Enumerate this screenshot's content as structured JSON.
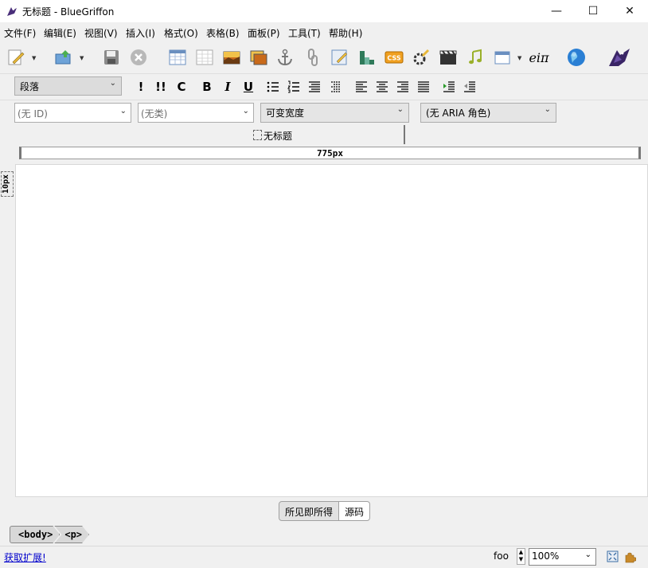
{
  "window": {
    "title": "无标题 - BlueGriffon",
    "minimize_glyph": "—",
    "maximize_glyph": "☐",
    "close_glyph": "✕"
  },
  "menu": [
    {
      "label": "文件(F)"
    },
    {
      "label": "编辑(E)"
    },
    {
      "label": "视图(V)"
    },
    {
      "label": "插入(I)"
    },
    {
      "label": "格式(O)"
    },
    {
      "label": "表格(B)"
    },
    {
      "label": "面板(P)"
    },
    {
      "label": "工具(T)"
    },
    {
      "label": "帮助(H)"
    }
  ],
  "toolbar": {
    "icons": [
      "new-document-icon",
      "publish-icon",
      "save-icon",
      "stop-icon",
      "table-icon",
      "grid-icon",
      "image-icon",
      "photo-gallery-icon",
      "anchor-icon",
      "link-icon",
      "form-icon",
      "chart-icon",
      "css-icon",
      "gear-icon",
      "video-icon",
      "audio-icon",
      "window-icon",
      "math-icon",
      "globe-icon",
      "bluegriffon-icon"
    ],
    "math_label": "eiπ",
    "css_label": "CSS"
  },
  "format": {
    "paragraph_select": "段落",
    "buttons": [
      {
        "label": "!"
      },
      {
        "label": "!!"
      },
      {
        "label": "C"
      },
      {
        "label": "B"
      },
      {
        "label": "I"
      },
      {
        "label": "U"
      }
    ]
  },
  "attributes": {
    "id_select": "(无 ID)",
    "class_select": "(无类)",
    "width_select": "可变宽度",
    "aria_select": "(无 ARIA 角色)"
  },
  "document_tab": {
    "label": "无标题"
  },
  "ruler": {
    "horizontal_label": "775px",
    "vertical_label": "10px"
  },
  "mode_tabs": {
    "wysiwyg": "所见即所得",
    "source": "源码"
  },
  "breadcrumb": [
    "<body>",
    "<p>"
  ],
  "statusbar": {
    "extensions_link": "获取扩展!",
    "foo_label": "foo",
    "zoom": "100%"
  },
  "colors": {
    "window_bg": "#f0f0f0",
    "editor_bg": "#ffffff",
    "link": "#0000cc"
  }
}
